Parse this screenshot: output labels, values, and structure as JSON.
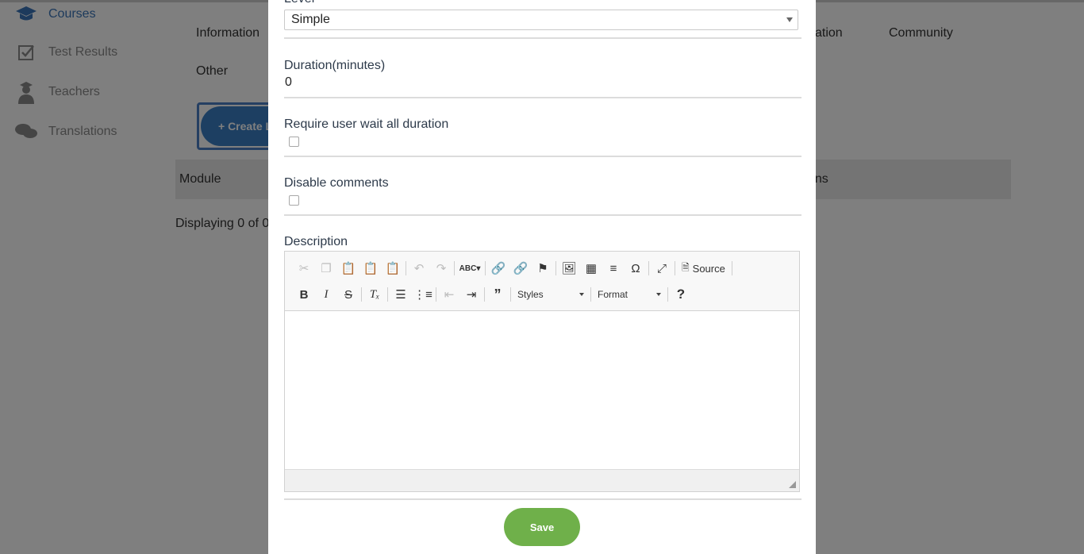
{
  "sidebar": {
    "items": [
      {
        "label": "Courses",
        "icon": "graduation-cap-icon",
        "active": true
      },
      {
        "label": "Test Results",
        "icon": "checkbox-icon"
      },
      {
        "label": "Teachers",
        "icon": "teacher-icon"
      },
      {
        "label": "Translations",
        "icon": "chat-bubbles-icon"
      }
    ]
  },
  "main": {
    "tabs": {
      "information": "Information",
      "ation": "ation",
      "community": "Community",
      "other": "Other"
    },
    "create_button": "+ Create L",
    "table": {
      "col_module": "Module",
      "col_ons": "ons"
    },
    "displaying": "Displaying 0 of 0"
  },
  "modal": {
    "level_label": "Level",
    "level_value": "Simple",
    "duration_label": "Duration(minutes)",
    "duration_value": "0",
    "wait_label": "Require user wait all duration",
    "disable_comments_label": "Disable comments",
    "description_label": "Description",
    "toolbar": {
      "source_label": "Source",
      "styles_label": "Styles",
      "format_label": "Format",
      "help_label": "?"
    },
    "save_label": "Save"
  },
  "colors": {
    "accent": "#3a7fc5",
    "save": "#6fb04a",
    "overlay": "rgba(0,0,0,0.5)"
  }
}
